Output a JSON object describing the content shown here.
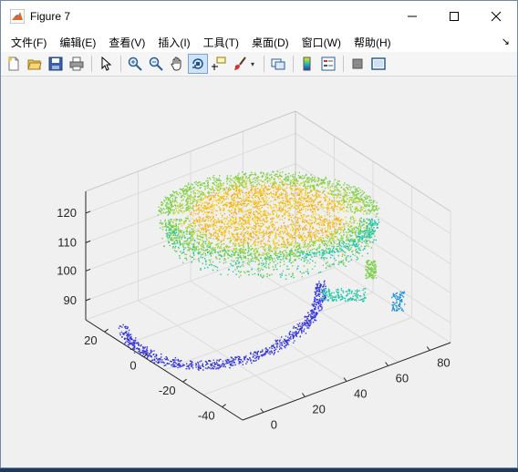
{
  "window": {
    "title": "Figure 7"
  },
  "menu": {
    "items": [
      {
        "label": "文件(F)",
        "name": "menu-file"
      },
      {
        "label": "编辑(E)",
        "name": "menu-edit"
      },
      {
        "label": "查看(V)",
        "name": "menu-view"
      },
      {
        "label": "插入(I)",
        "name": "menu-insert"
      },
      {
        "label": "工具(T)",
        "name": "menu-tools"
      },
      {
        "label": "桌面(D)",
        "name": "menu-desktop"
      },
      {
        "label": "窗口(W)",
        "name": "menu-window"
      },
      {
        "label": "帮助(H)",
        "name": "menu-help"
      }
    ],
    "overflow_arrow": "↘"
  },
  "toolbar": {
    "groups": [
      [
        "new-figure-icon",
        "open-file-icon",
        "save-icon",
        "print-icon"
      ],
      [
        "pointer-icon"
      ],
      [
        "zoom-in-icon",
        "zoom-out-icon",
        "pan-hand-icon",
        "rotate-3d-icon",
        "data-cursor-icon",
        "brush-icon"
      ],
      [
        "link-plot-icon"
      ],
      [
        "colorbar-icon",
        "legend-icon"
      ],
      [
        "hide-plot-tools-icon",
        "show-plot-tools-icon"
      ]
    ],
    "active": "rotate-3d-icon"
  },
  "plot": {
    "z_ticks": [
      "90",
      "100",
      "110",
      "120"
    ],
    "y_ticks": [
      "20",
      "0",
      "-20",
      "-40"
    ],
    "x_ticks": [
      "0",
      "20",
      "40",
      "60",
      "80"
    ]
  },
  "chart_data": {
    "type": "scatter",
    "title": "",
    "xlabel": "",
    "ylabel": "",
    "zlabel": "",
    "x_ticks": [
      0,
      20,
      40,
      60,
      80
    ],
    "y_ticks": [
      20,
      0,
      -20,
      -40
    ],
    "z_ticks": [
      90,
      100,
      110,
      120
    ],
    "grid": true,
    "colors": [
      "#3030d8",
      "#1c8fd6",
      "#1bc7a6",
      "#7fd04a",
      "#f2d31b",
      "#f5a623"
    ],
    "description_series": [
      {
        "name": "",
        "values": []
      }
    ]
  }
}
